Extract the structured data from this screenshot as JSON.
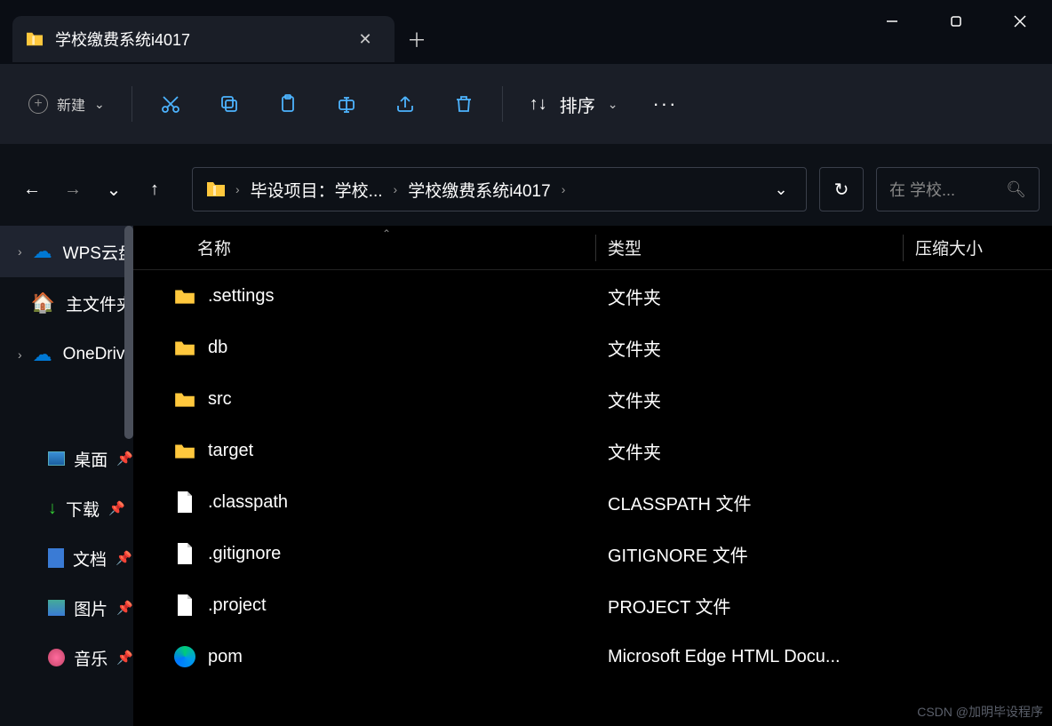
{
  "tab": {
    "title": "学校缴费系统i4017"
  },
  "toolbar": {
    "new_label": "新建",
    "sort_label": "排序"
  },
  "breadcrumb": {
    "seg1": "毕设项目：学校...",
    "seg2": "学校缴费系统i4017"
  },
  "search": {
    "placeholder": "在 学校..."
  },
  "sidebar": {
    "items": [
      {
        "label": "WPS云盘"
      },
      {
        "label": "主文件夹"
      },
      {
        "label": "OneDrive"
      }
    ],
    "quick": [
      {
        "label": "桌面"
      },
      {
        "label": "下载"
      },
      {
        "label": "文档"
      },
      {
        "label": "图片"
      },
      {
        "label": "音乐"
      }
    ]
  },
  "columns": {
    "name": "名称",
    "type": "类型",
    "size": "压缩大小"
  },
  "files": [
    {
      "name": ".settings",
      "type": "文件夹",
      "icon": "folder"
    },
    {
      "name": "db",
      "type": "文件夹",
      "icon": "folder"
    },
    {
      "name": "src",
      "type": "文件夹",
      "icon": "folder"
    },
    {
      "name": "target",
      "type": "文件夹",
      "icon": "folder"
    },
    {
      "name": ".classpath",
      "type": "CLASSPATH 文件",
      "icon": "file"
    },
    {
      "name": ".gitignore",
      "type": "GITIGNORE 文件",
      "icon": "file"
    },
    {
      "name": ".project",
      "type": "PROJECT 文件",
      "icon": "file"
    },
    {
      "name": "pom",
      "type": "Microsoft Edge HTML Docu...",
      "icon": "edge"
    }
  ],
  "watermark": "CSDN @加明毕设程序"
}
